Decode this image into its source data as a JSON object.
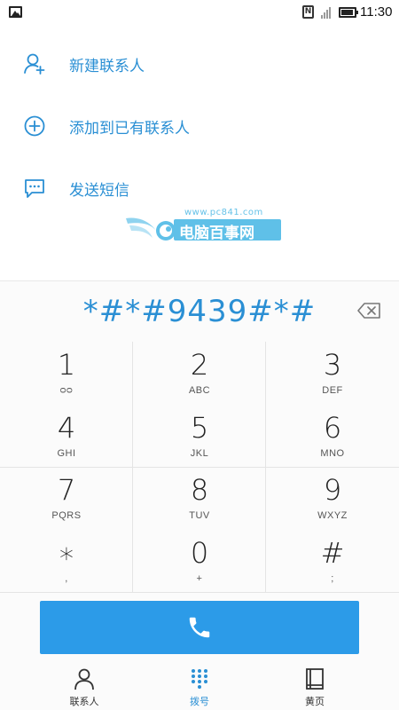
{
  "status_bar": {
    "time": "11:30",
    "icons": [
      "image-notification-icon",
      "nfc-icon",
      "signal-icon",
      "battery-icon"
    ]
  },
  "actions": [
    {
      "label": "新建联系人",
      "icon": "add-person-icon"
    },
    {
      "label": "添加到已有联系人",
      "icon": "plus-circle-icon"
    },
    {
      "label": "发送短信",
      "icon": "message-icon"
    }
  ],
  "watermark": {
    "url": "www.pc841.com",
    "text": "电脑百事网"
  },
  "dialer": {
    "number": "*#*#9439#*#",
    "backspace_icon": "backspace-icon"
  },
  "keypad": [
    {
      "digit": "1",
      "letters": "ᴑᴑ"
    },
    {
      "digit": "2",
      "letters": "ABC"
    },
    {
      "digit": "3",
      "letters": "DEF"
    },
    {
      "digit": "4",
      "letters": "GHI"
    },
    {
      "digit": "5",
      "letters": "JKL"
    },
    {
      "digit": "6",
      "letters": "MNO"
    },
    {
      "digit": "7",
      "letters": "PQRS"
    },
    {
      "digit": "8",
      "letters": "TUV"
    },
    {
      "digit": "9",
      "letters": "WXYZ"
    },
    {
      "digit": "∗",
      "letters": ","
    },
    {
      "digit": "0",
      "letters": "+"
    },
    {
      "digit": "#",
      "letters": ";"
    }
  ],
  "call_button": {
    "icon": "phone-icon"
  },
  "bottom_nav": [
    {
      "label": "联系人",
      "icon": "person-icon",
      "active": false
    },
    {
      "label": "拨号",
      "icon": "dialpad-icon",
      "active": true
    },
    {
      "label": "黄页",
      "icon": "book-icon",
      "active": false
    }
  ],
  "colors": {
    "accent": "#2a8fd4",
    "call_button": "#2c9be8",
    "watermark": "#5fc0e8"
  }
}
